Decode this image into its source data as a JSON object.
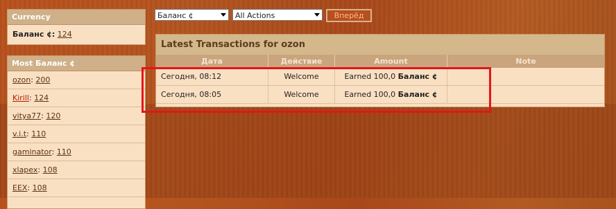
{
  "sidebar": {
    "currency": {
      "title": "Currency",
      "balance_label": "Баланс ¢:",
      "balance_value": "124"
    },
    "most": {
      "title": "Most Баланс ¢",
      "items": [
        {
          "name": "ozon",
          "value": "200"
        },
        {
          "name": "Kirill",
          "value": "124"
        },
        {
          "name": "vitya77",
          "value": "120"
        },
        {
          "name": "v.i.t",
          "value": "110"
        },
        {
          "name": "gaminator",
          "value": "110"
        },
        {
          "name": "xlapex",
          "value": "108"
        },
        {
          "name": "EEX",
          "value": "108"
        }
      ]
    }
  },
  "filters": {
    "currency_select": "Баланс ¢",
    "actions_select": "All Actions",
    "go_button": "Вперёд"
  },
  "transactions": {
    "title": "Latest Transactions for ozon",
    "columns": [
      "Дата",
      "Действие",
      "Amount",
      "Note"
    ],
    "rows": [
      {
        "date": "Сегодня, 08:12",
        "action": "Welcome",
        "amount_text": "Earned 100,0",
        "currency": "Баланс ¢",
        "note": ""
      },
      {
        "date": "Сегодня, 08:05",
        "action": "Welcome",
        "amount_text": "Earned 100,0",
        "currency": "Баланс ¢",
        "note": ""
      }
    ]
  },
  "colors": {
    "highlight": "#e5141a",
    "background": "#b3541f",
    "panel": "#fae0c2"
  }
}
